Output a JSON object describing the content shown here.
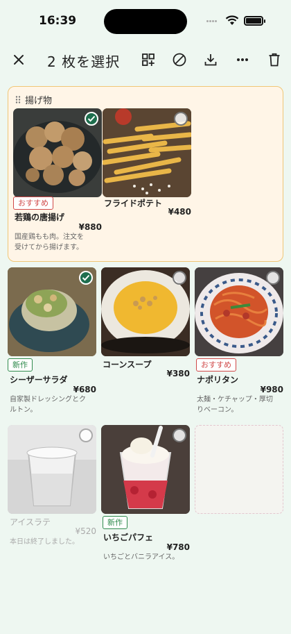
{
  "status": {
    "time": "16:39"
  },
  "toolbar": {
    "title": "2 枚を選択"
  },
  "group": {
    "title": "揚げ物",
    "items": [
      {
        "name": "若鶏の唐揚げ",
        "price": "¥880",
        "badge": "おすすめ",
        "desc_line1": "国産鶏もも肉。注文を",
        "desc_line2": "受けてから揚げます。",
        "selected": true
      },
      {
        "name": "フライドポテト",
        "price": "¥480",
        "selected": false
      }
    ]
  },
  "items": [
    {
      "name": "シーザーサラダ",
      "price": "¥680",
      "badge": "新作",
      "desc_line1": "自家製ドレッシングとク",
      "desc_line2": "ルトン。",
      "selected": true
    },
    {
      "name": "コーンスープ",
      "price": "¥380",
      "selected": false
    },
    {
      "name": "ナポリタン",
      "price": "¥980",
      "badge": "おすすめ",
      "desc_line1": "太麺・ケチャップ・厚切",
      "desc_line2": "りベーコン。",
      "selected": false
    },
    {
      "name": "アイスラテ",
      "price": "¥520",
      "desc_line1": "本日は終了しました。",
      "selected": false,
      "sold_out": true
    },
    {
      "name": "いちごパフェ",
      "price": "¥780",
      "badge": "新作",
      "desc_line1": "いちごとバニラアイス。",
      "selected": false
    }
  ],
  "colors": {
    "accent": "#1e6e4e",
    "badge_recommend": "#d04848",
    "badge_new": "#2f8a4c",
    "group_border": "#f0c676",
    "group_bg": "#fff5e7"
  }
}
